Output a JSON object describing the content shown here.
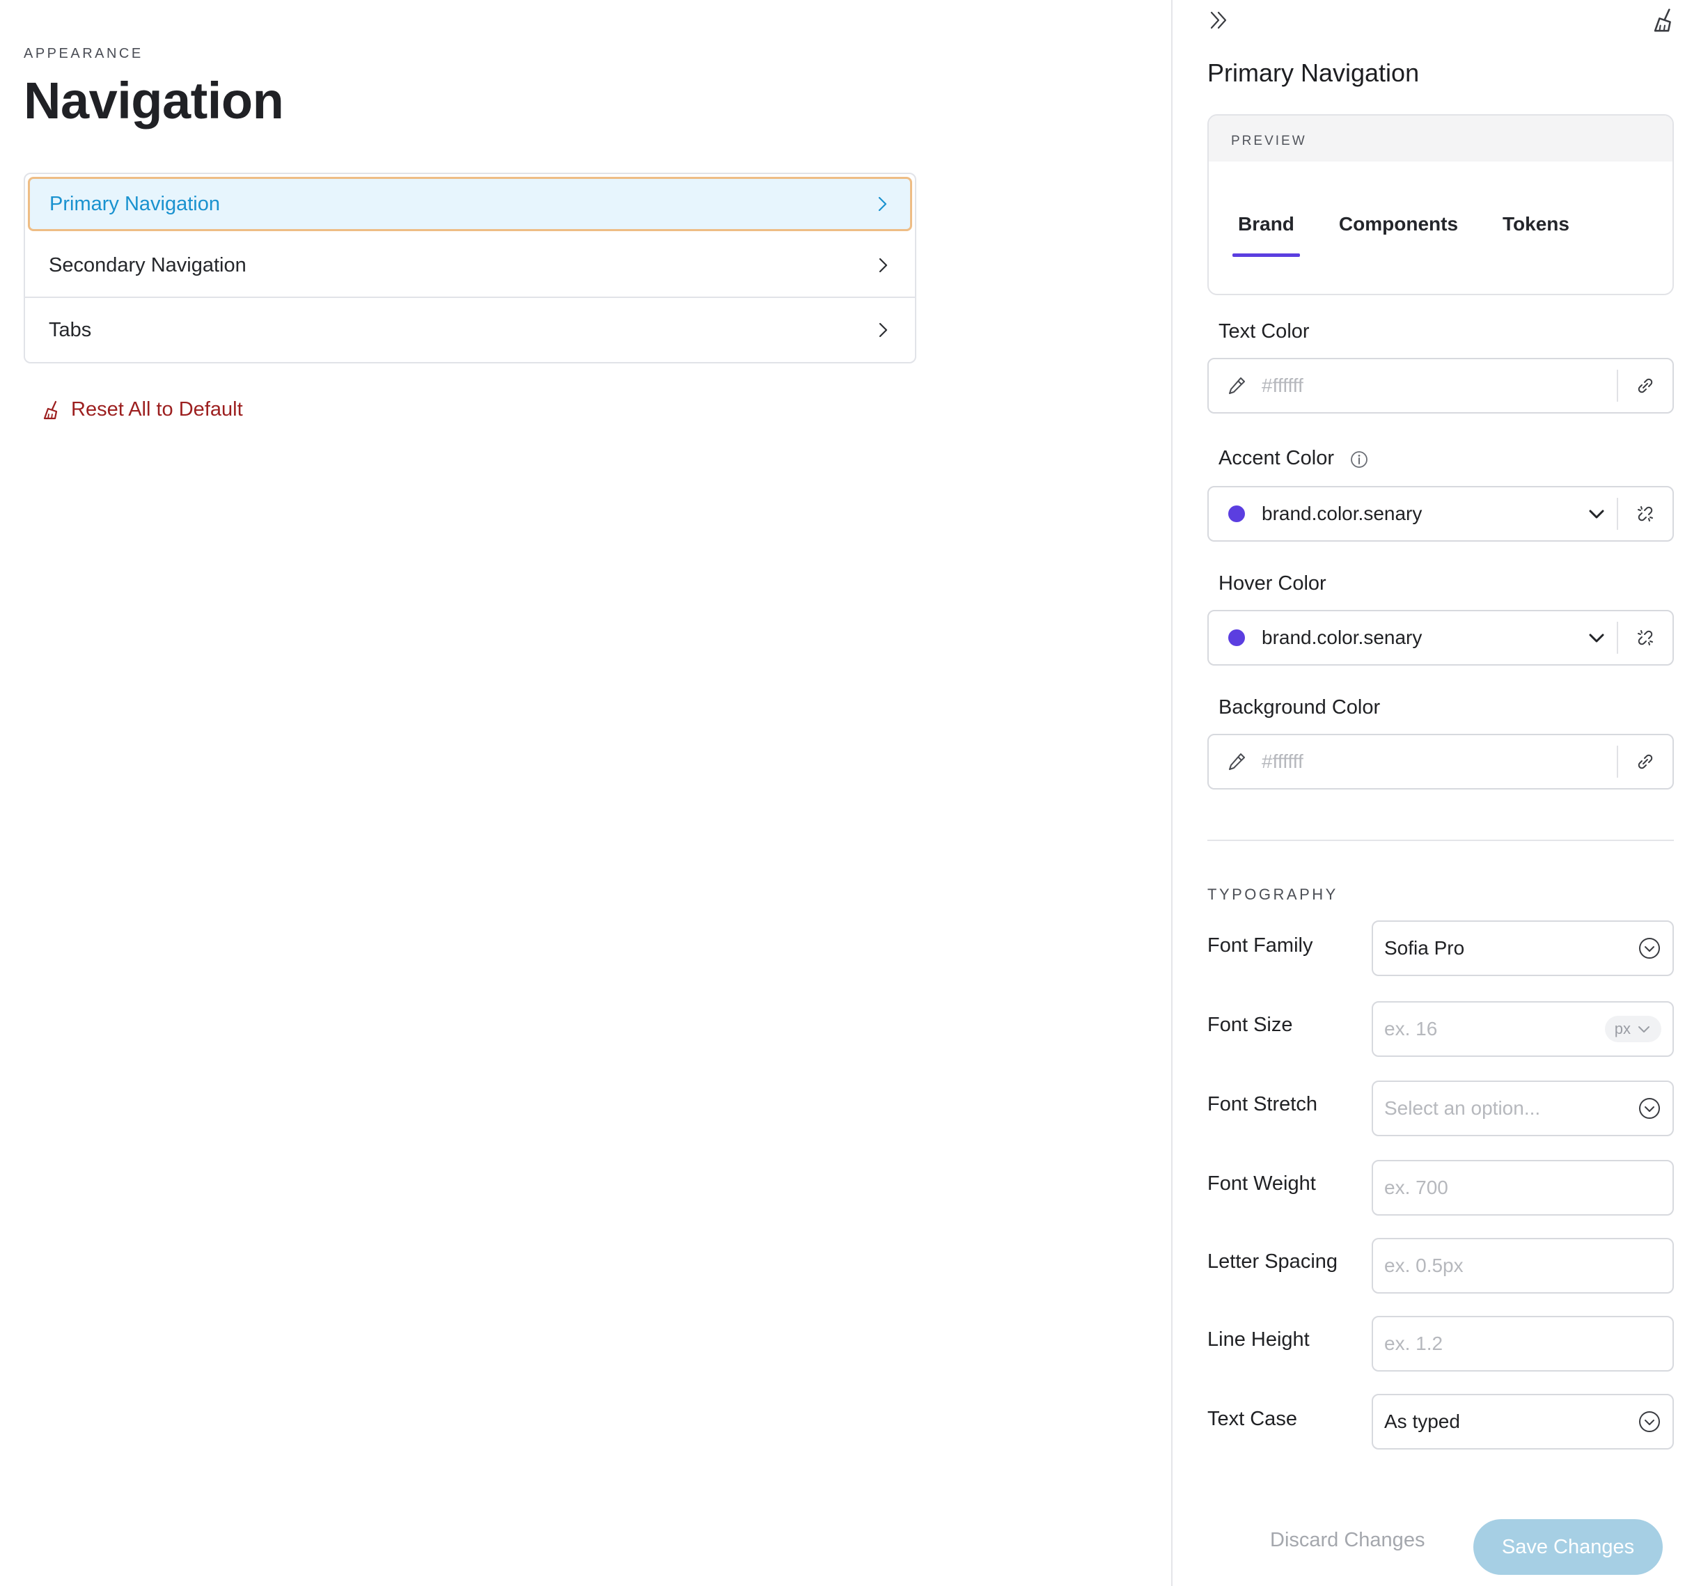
{
  "left": {
    "eyebrow": "APPEARANCE",
    "title": "Navigation",
    "items": [
      {
        "label": "Primary Navigation",
        "active": true
      },
      {
        "label": "Secondary Navigation",
        "active": false
      },
      {
        "label": "Tabs",
        "active": false
      }
    ],
    "reset_label": "Reset All to Default"
  },
  "panel": {
    "title": "Primary Navigation",
    "preview": {
      "heading": "PREVIEW",
      "tabs": [
        "Brand",
        "Components",
        "Tokens"
      ],
      "active_tab": "Brand"
    },
    "text_color": {
      "label": "Text Color",
      "placeholder": "#ffffff"
    },
    "accent_color": {
      "label": "Accent Color",
      "value": "brand.color.senary",
      "swatch": "#5b3ee0"
    },
    "hover_color": {
      "label": "Hover Color",
      "value": "brand.color.senary",
      "swatch": "#5b3ee0"
    },
    "background_color": {
      "label": "Background Color",
      "placeholder": "#ffffff"
    },
    "typography": {
      "heading": "TYPOGRAPHY",
      "font_family": {
        "label": "Font Family",
        "value": "Sofia Pro"
      },
      "font_size": {
        "label": "Font Size",
        "placeholder": "ex. 16",
        "unit": "px"
      },
      "font_stretch": {
        "label": "Font Stretch",
        "placeholder": "Select an option..."
      },
      "font_weight": {
        "label": "Font Weight",
        "placeholder": "ex. 700"
      },
      "letter_spacing": {
        "label": "Letter Spacing",
        "placeholder": "ex. 0.5px"
      },
      "line_height": {
        "label": "Line Height",
        "placeholder": "ex. 1.2"
      },
      "text_case": {
        "label": "Text Case",
        "value": "As typed"
      }
    },
    "discard_label": "Discard Changes",
    "save_label": "Save Changes"
  },
  "colors": {
    "accent": "#5b3ee0",
    "active_item_bg": "#e7f5fd",
    "active_item_text": "#1a92cf",
    "active_item_border": "#eebd85",
    "danger": "#9c1f1f",
    "save_button": "#a6cfe4"
  }
}
